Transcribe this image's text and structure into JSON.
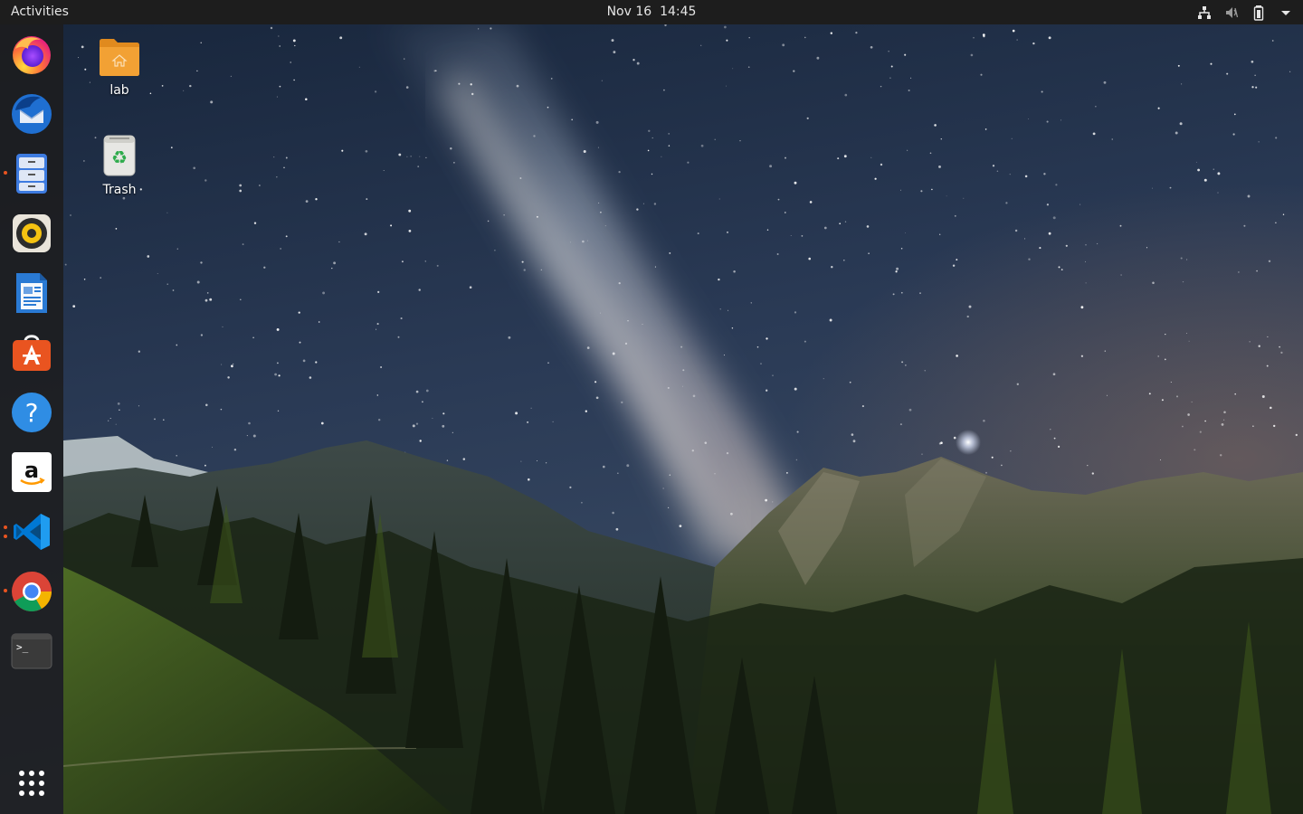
{
  "topbar": {
    "activities_label": "Activities",
    "clock_text": "Nov 16  14:45",
    "tray_icons": [
      "network-icon",
      "volume-muted-icon",
      "battery-icon",
      "system-menu-arrow-icon"
    ]
  },
  "dock": {
    "apps": [
      {
        "name": "Firefox",
        "icon": "firefox-icon",
        "running": false
      },
      {
        "name": "Thunderbird",
        "icon": "thunderbird-icon",
        "running": false
      },
      {
        "name": "Files",
        "icon": "files-icon",
        "running": true
      },
      {
        "name": "Rhythmbox",
        "icon": "rhythmbox-icon",
        "running": false
      },
      {
        "name": "LibreOffice Writer",
        "icon": "writer-icon",
        "running": false
      },
      {
        "name": "Ubuntu Software",
        "icon": "software-icon",
        "running": false
      },
      {
        "name": "Help",
        "icon": "help-icon",
        "running": false
      },
      {
        "name": "Amazon",
        "icon": "amazon-icon",
        "running": false
      },
      {
        "name": "Visual Studio Code",
        "icon": "vscode-icon",
        "running": true
      },
      {
        "name": "Google Chrome",
        "icon": "chrome-icon",
        "running": true
      },
      {
        "name": "Terminal",
        "icon": "terminal-icon",
        "running": false
      }
    ],
    "show_apps_icon": "app-grid-icon",
    "accent_color": "#e95420"
  },
  "desktop": {
    "icons": [
      {
        "label": "lab",
        "icon": "home-folder-icon"
      },
      {
        "label": "Trash",
        "icon": "trash-icon"
      }
    ]
  },
  "colors": {
    "topbar_bg": "#1d1d1d",
    "dock_bg": "#1c1c1e",
    "folder_orange": "#f2a134"
  }
}
